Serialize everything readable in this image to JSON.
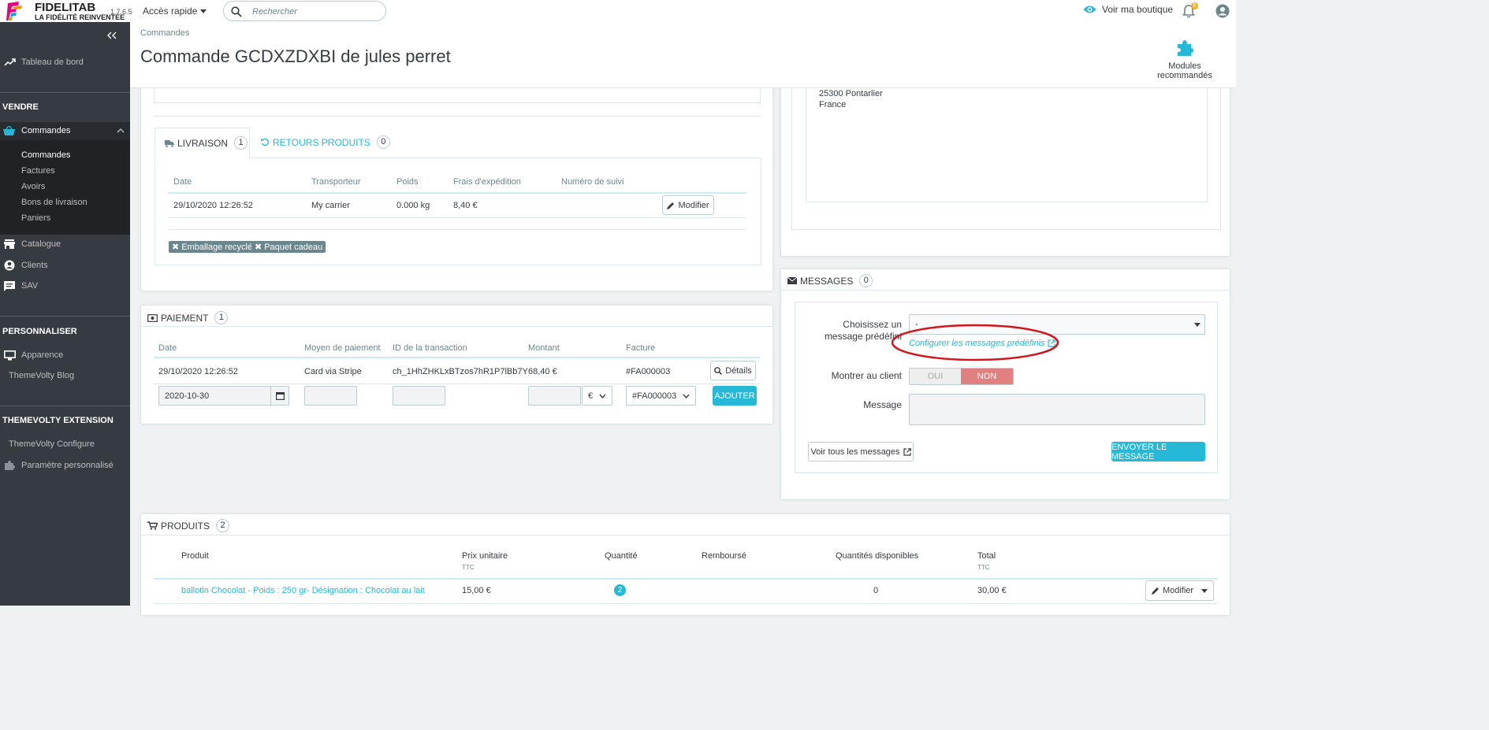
{
  "topbar": {
    "brand_name": "FIDELITAB",
    "brand_tagline": "LA FIDÉLITÉ REINVENTÉE",
    "version": "1.7.6.5",
    "quick_access": "Accès rapide",
    "search_placeholder": "Rechercher",
    "view_shop": "Voir ma boutique",
    "notifications_count": "6"
  },
  "sidebar": {
    "dashboard": "Tableau de bord",
    "section_sell": "VENDRE",
    "orders": "Commandes",
    "orders_sub": [
      "Commandes",
      "Factures",
      "Avoirs",
      "Bons de livraison",
      "Paniers"
    ],
    "catalog": "Catalogue",
    "clients": "Clients",
    "sav": "SAV",
    "section_customize": "PERSONNALISER",
    "appearance": "Apparence",
    "blog": "ThemeVolty Blog",
    "section_extension": "THEMEVOLTY EXTENSION",
    "tv_configure": "ThemeVolty Configure",
    "custom_param": "Paramètre personnalisé"
  },
  "header": {
    "breadcrumb": "Commandes",
    "title": "Commande GCDXZDXBI de jules perret",
    "recommended_modules": "Modules recommandés"
  },
  "shipping": {
    "tab_delivery": "LIVRAISON",
    "tab_delivery_count": "1",
    "tab_returns": "RETOURS PRODUITS",
    "tab_returns_count": "0",
    "columns": [
      "Date",
      "Transporteur",
      "Poids",
      "Frais d'expédition",
      "Numéro de suivi"
    ],
    "row": {
      "date": "29/10/2020 12:26:52",
      "carrier": "My carrier",
      "weight": "0.000 kg",
      "cost": "8,40 €"
    },
    "edit_button": "Modifier",
    "tags": [
      "Emballage recyclé",
      "Paquet cadeau"
    ]
  },
  "address": {
    "city": "25300 Pontarlier",
    "country": "France"
  },
  "payment": {
    "title": "PAIEMENT",
    "count": "1",
    "columns": [
      "Date",
      "Moyen de paiement",
      "ID de la transaction",
      "Montant",
      "Facture"
    ],
    "row": {
      "date": "29/10/2020 12:26:52",
      "method": "Card via Stripe",
      "transaction_id": "ch_1HhZHKLxBTzos7hR1P7lBb7Y",
      "amount": "68,40 €",
      "invoice": "#FA000003"
    },
    "details_button": "Détails",
    "new_date": "2020-10-30",
    "currency": "€",
    "invoice_select": "#FA000003",
    "add_button": "AJOUTER"
  },
  "messages": {
    "title": "MESSAGES",
    "count": "0",
    "choose_label": "Choisissez un message prédéfini",
    "choose_value": "-",
    "configure_link": "Configurer les messages prédéfinis",
    "show_client_label": "Montrer au client",
    "toggle_yes": "OUI",
    "toggle_no": "NON",
    "message_label": "Message",
    "view_all_button": "Voir tous les messages",
    "send_button": "ENVOYER LE MESSAGE"
  },
  "products": {
    "title": "PRODUITS",
    "count": "2",
    "columns": [
      "Produit",
      "Prix unitaire",
      "Quantité",
      "Remboursé",
      "Quantités disponibles",
      "Total"
    ],
    "ttc": "TTC",
    "row": {
      "name": "ballotin Chocolat - Poids : 250 gr- Désignation : Chocolat au lait",
      "unit_price": "15,00 €",
      "quantity": "2",
      "available": "0",
      "total": "30,00 €"
    },
    "edit_button": "Modifier"
  },
  "colors": {
    "accent": "#25b9d7",
    "sidebar": "#363a41",
    "highlight_circle": "#d0151b",
    "toggle_no": "#e08080"
  }
}
